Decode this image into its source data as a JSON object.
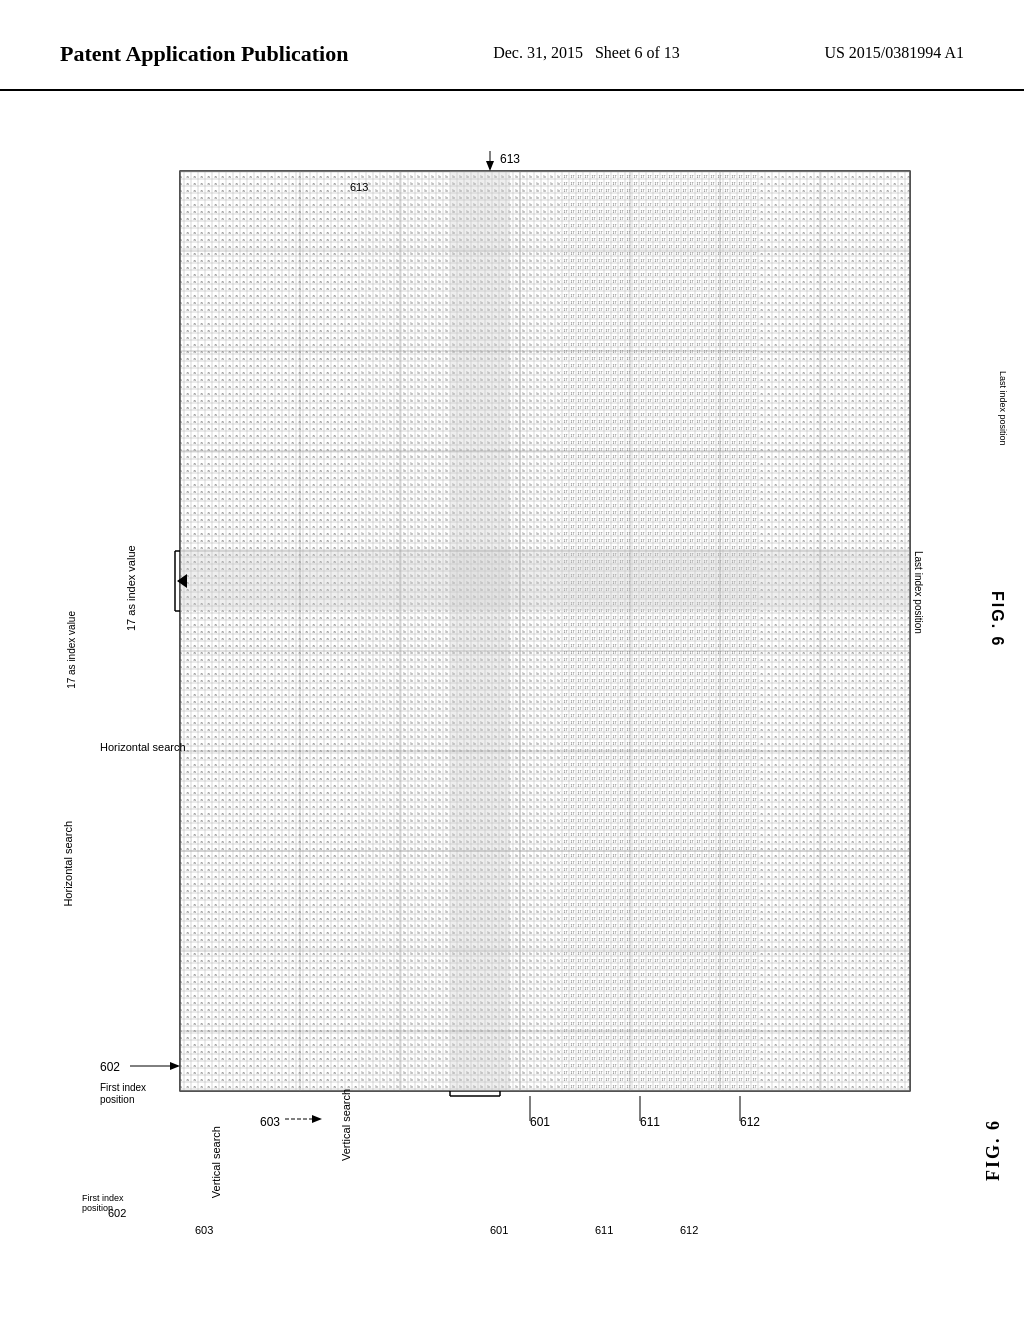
{
  "header": {
    "title": "Patent Application Publication",
    "date": "Dec. 31, 2015",
    "sheet": "Sheet 6 of 13",
    "patent_number": "US 2015/0381994 A1"
  },
  "figure": {
    "label": "FIG. 6",
    "ref_numbers": {
      "r601": "601",
      "r602": "602",
      "r603": "603",
      "r611": "611",
      "r612": "612",
      "r613": "613"
    },
    "labels": {
      "horizontal_search": "Horizontal search",
      "vertical_search": "Vertical search",
      "first_index_position": "First index\nposition",
      "last_index_position": "Last index position",
      "index_value": "17 as index value"
    }
  }
}
